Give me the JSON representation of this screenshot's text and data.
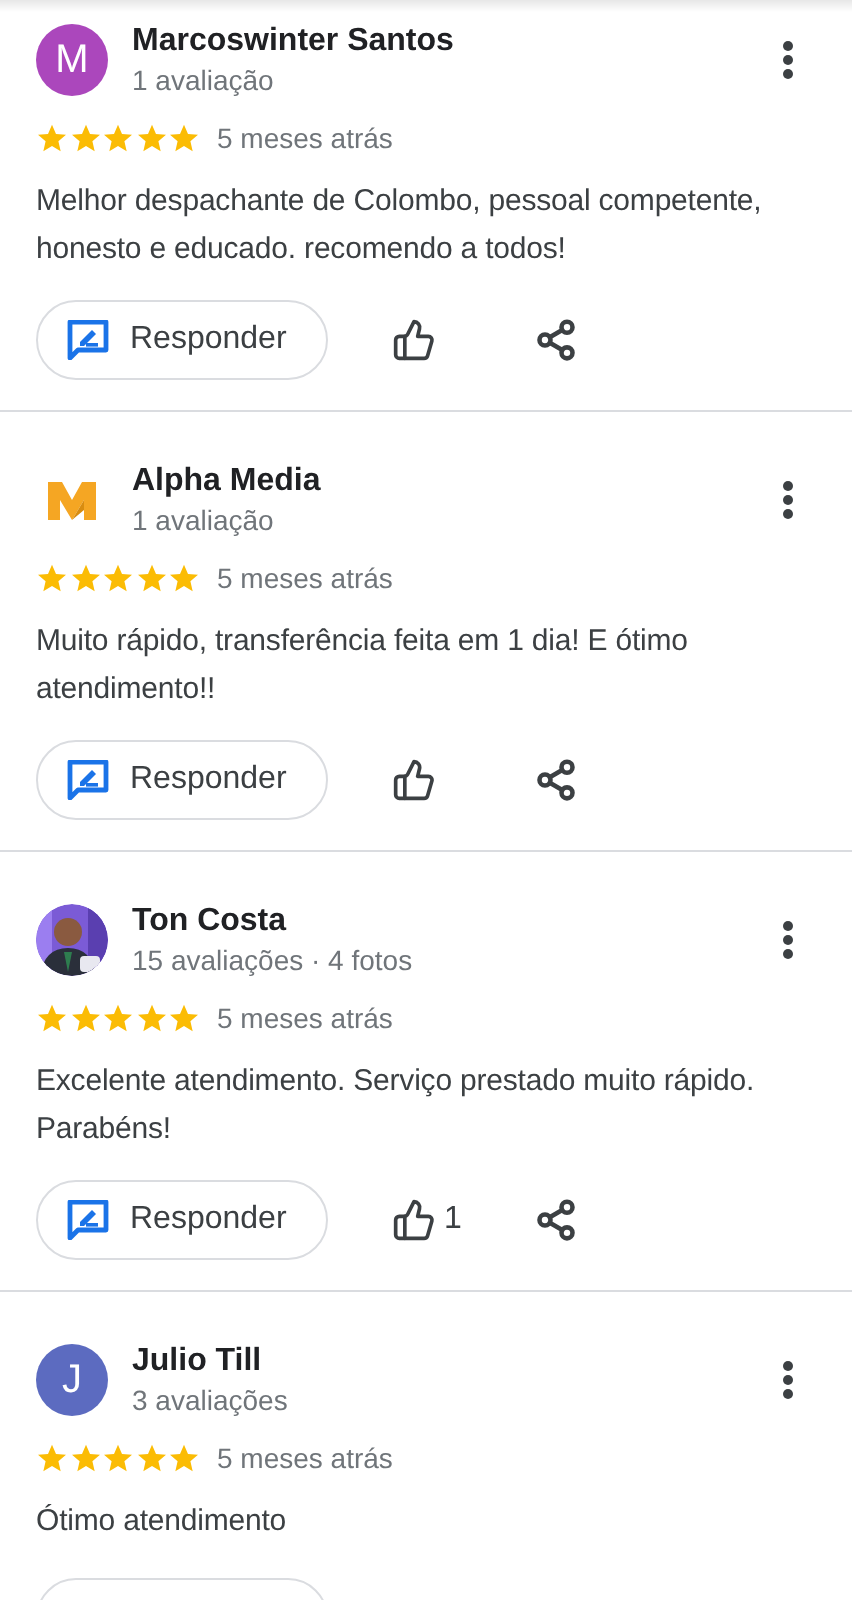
{
  "reviews": [
    {
      "avatar": {
        "kind": "letter",
        "letter": "M",
        "color": "#ab47bc"
      },
      "name": "Marcoswinter Santos",
      "meta": "1 avaliação",
      "stars": 5,
      "time": "5 meses atrás",
      "text": "Melhor despachante de Colombo, pessoal competente, honesto e educado. recomendo a todos!",
      "actions_visible": true,
      "reply": "Responder"
    },
    {
      "avatar": {
        "kind": "logo"
      },
      "name": "Alpha Media",
      "meta": "1 avaliação",
      "stars": 5,
      "time": "5 meses atrás",
      "text": "Muito rápido, transferência feita em 1 dia! E ótimo atendimento!!",
      "actions_visible": true,
      "reply": "Responder"
    },
    {
      "name": "Ton Costa",
      "meta": "15 avaliações · 4 fotos",
      "stars": 5,
      "time": "5 meses atrás",
      "text": "Excelente atendimento. Serviço prestado muito rápido. Parabéns!",
      "actions_visible": true,
      "reply": "Responder",
      "likes": "1"
    },
    {
      "avatar": {
        "kind": "letter",
        "letter": "J",
        "color": "#5c6bc0"
      },
      "name": "Julio Till",
      "meta": "3 avaliações",
      "stars": 5,
      "time": "5 meses atrás",
      "text": "Ótimo atendimento",
      "actions_visible": false
    }
  ]
}
